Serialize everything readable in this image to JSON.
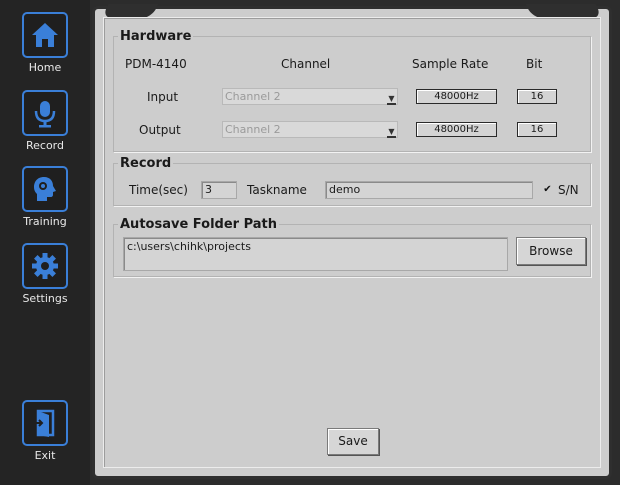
{
  "sidebar": {
    "items": [
      {
        "label": "Home"
      },
      {
        "label": "Record"
      },
      {
        "label": "Training"
      },
      {
        "label": "Settings"
      }
    ],
    "exit_label": "Exit"
  },
  "hardware": {
    "title": "Hardware",
    "device": "PDM-4140",
    "col_channel": "Channel",
    "col_sample_rate": "Sample Rate",
    "col_bit": "Bit",
    "input": {
      "label": "Input",
      "channel": "Channel 2",
      "sample_rate": "48000Hz",
      "bit": "16"
    },
    "output": {
      "label": "Output",
      "channel": "Channel 2",
      "sample_rate": "48000Hz",
      "bit": "16"
    }
  },
  "record": {
    "title": "Record",
    "time_label": "Time(sec)",
    "time_value": "3",
    "taskname_label": "Taskname",
    "taskname_value": "demo",
    "sn_label": "S/N",
    "sn_checked": true
  },
  "autosave": {
    "title": "Autosave Folder Path",
    "path": "c:\\users\\chihk\\projects",
    "browse_label": "Browse"
  },
  "save_label": "Save",
  "colors": {
    "accent": "#3a7fd8",
    "sidebar_bg": "#242424",
    "panel_bg": "#cdcdcd"
  }
}
